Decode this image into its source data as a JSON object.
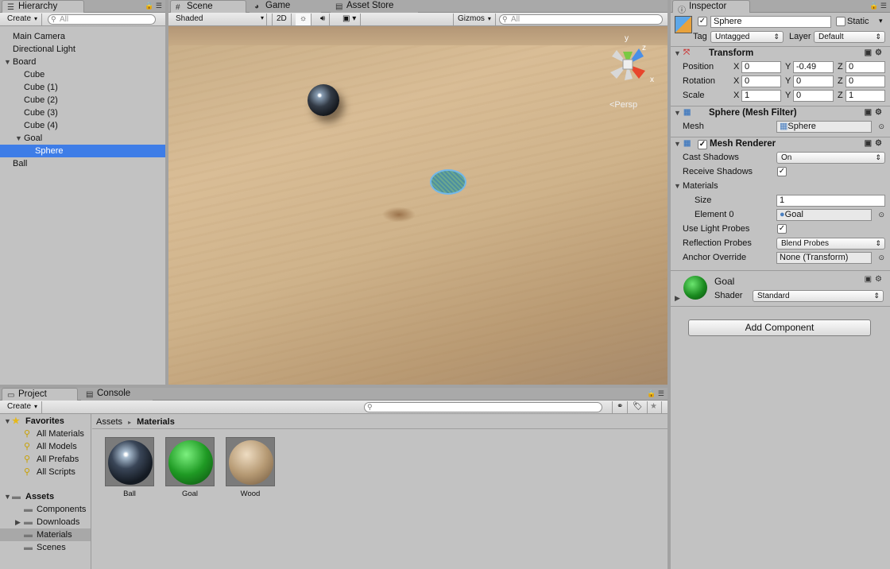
{
  "hierarchy": {
    "tab": "Hierarchy",
    "create": "Create",
    "search_placeholder": "All",
    "items": [
      {
        "label": "Main Camera"
      },
      {
        "label": "Directional Light"
      },
      {
        "label": "Board"
      },
      {
        "label": "Cube"
      },
      {
        "label": "Cube (1)"
      },
      {
        "label": "Cube (2)"
      },
      {
        "label": "Cube (3)"
      },
      {
        "label": "Cube (4)"
      },
      {
        "label": "Goal"
      },
      {
        "label": "Sphere"
      },
      {
        "label": "Ball"
      }
    ]
  },
  "scene": {
    "tabs": [
      "Scene",
      "Game",
      "Asset Store"
    ],
    "shading": "Shaded",
    "mode_2d": "2D",
    "gizmos": "Gizmos",
    "search_placeholder": "All",
    "persp": "<Persp",
    "axis_y": "y",
    "axis_z": "z",
    "axis_x": "x"
  },
  "inspector": {
    "tab": "Inspector",
    "object_name": "Sphere",
    "static_label": "Static",
    "tag_label": "Tag",
    "tag_value": "Untagged",
    "layer_label": "Layer",
    "layer_value": "Default",
    "transform": {
      "title": "Transform",
      "position_label": "Position",
      "position": {
        "x": "0",
        "y": "-0.49",
        "z": "0"
      },
      "rotation_label": "Rotation",
      "rotation": {
        "x": "0",
        "y": "0",
        "z": "0"
      },
      "scale_label": "Scale",
      "scale": {
        "x": "1",
        "y": "0",
        "z": "1"
      },
      "x": "X",
      "y": "Y",
      "z": "Z"
    },
    "mesh_filter": {
      "title": "Sphere (Mesh Filter)",
      "mesh_label": "Mesh",
      "mesh_value": "Sphere"
    },
    "mesh_renderer": {
      "title": "Mesh Renderer",
      "cast_shadows_label": "Cast Shadows",
      "cast_shadows": "On",
      "receive_shadows_label": "Receive Shadows",
      "materials_label": "Materials",
      "size_label": "Size",
      "size": "1",
      "element0_label": "Element 0",
      "element0": "Goal",
      "light_probes_label": "Use Light Probes",
      "reflection_probes_label": "Reflection Probes",
      "reflection_probes": "Blend Probes",
      "anchor_label": "Anchor Override",
      "anchor": "None (Transform)"
    },
    "material": {
      "name": "Goal",
      "shader_label": "Shader",
      "shader": "Standard"
    },
    "add_component": "Add Component"
  },
  "project": {
    "tabs": [
      "Project",
      "Console"
    ],
    "create": "Create",
    "favorites_label": "Favorites",
    "favorites": [
      "All Materials",
      "All Models",
      "All Prefabs",
      "All Scripts"
    ],
    "assets_label": "Assets",
    "folders": [
      "Components",
      "Downloads",
      "Materials",
      "Scenes"
    ],
    "breadcrumb": [
      "Assets",
      "Materials"
    ],
    "breadcrumb_sep": "▸",
    "assets": [
      {
        "name": "Ball",
        "color": "#1c2430"
      },
      {
        "name": "Goal",
        "color": "#1a8a1f"
      },
      {
        "name": "Wood",
        "color": "#b69a74"
      }
    ]
  },
  "colors": {
    "selection": "#3e7de7",
    "panel": "#c2c2c2"
  }
}
